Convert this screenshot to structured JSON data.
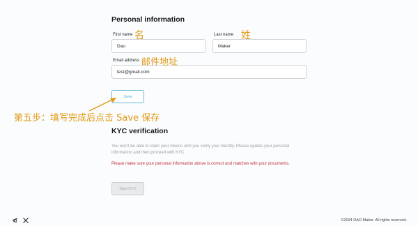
{
  "personal": {
    "title": "Personal information",
    "first_name_label": "First name",
    "first_name_value": "Dao",
    "last_name_label": "Last name",
    "last_name_value": "Maker",
    "email_label": "Email address",
    "email_value": "test@gmail.com",
    "save_label": "Save"
  },
  "kyc": {
    "title": "KYC verification",
    "note": "You won't be able to claim your tokens until you verify your identity. Please update your personal information and then proceed with KYC.",
    "warning": "Please make sure your personal information above is correct and matches with your documents.",
    "start_label": "Start KYC"
  },
  "annotations": {
    "first_name_hint": "名",
    "last_name_hint": "姓",
    "email_hint": "邮件地址",
    "step_hint": "第五步：填写完成后点击 Save 保存",
    "color": "#e19a17"
  },
  "footer": {
    "copyright": "©2024 DAO Maker. All rights reserved.",
    "icons": [
      "telegram-icon",
      "x-icon"
    ]
  }
}
